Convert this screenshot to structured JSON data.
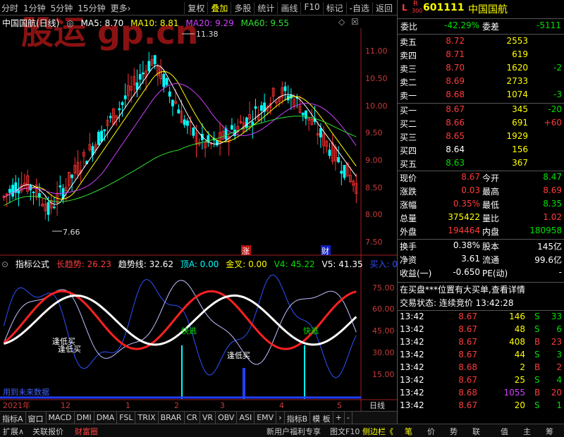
{
  "toolbar": {
    "left": [
      "分时",
      "1分钟",
      "5分钟",
      "15分钟",
      "更多›"
    ],
    "right": [
      "复权",
      "叠加",
      "多股",
      "统计",
      "画线",
      "F10",
      "标记",
      "-自选",
      "返回"
    ]
  },
  "watermark": "股运 gp.cn",
  "chart": {
    "name": "中国国航(日线)",
    "ma5": "MA5: 8.70",
    "ma10": "MA10: 8.81",
    "ma20": "MA20: 9.29",
    "ma60": "MA60: 9.55",
    "y_ticks": [
      "11.00",
      "10.50",
      "10.00",
      "9.50",
      "9.00",
      "8.50",
      "8.00",
      "7.50"
    ],
    "high_label": "11.38",
    "low_label": "7.66",
    "marker_zhang": "涨",
    "marker_cai": "财"
  },
  "indicator": {
    "label": "指标公式",
    "long_trend": "长趋势: 26.23",
    "trend_line": "趋势线: 32.62",
    "top_a": "顶A: 0.00",
    "golden_cross": "金叉: 0.00",
    "v4": "V4: 45.22",
    "v5": "V5: 41.35",
    "buy_in": "买入: 0.00",
    "y_ticks": [
      "75.00",
      "60.00",
      "45.00",
      "30.00",
      "15.00"
    ],
    "text_low_buy1": "逢低买",
    "text_low_buy2": "逢低买",
    "text_quick_sell1": "快逃",
    "text_quick_sell2": "快逃",
    "text_low_buy3": "逢低买",
    "text_future": "用到未来数据"
  },
  "axis": {
    "year": "2021年",
    "months": [
      "12",
      "1",
      "2",
      "3",
      "4",
      "5"
    ],
    "period": "日线"
  },
  "tabs": [
    "指标A",
    "窗口",
    "MACD",
    "DMI",
    "DMA",
    "FSL",
    "TRIX",
    "BRAR",
    "CR",
    "VR",
    "OBV",
    "ASI",
    "EMV",
    "›",
    "指标B",
    "模 板",
    "+",
    "-"
  ],
  "status": {
    "left": [
      "扩展∧",
      "关联报价",
      "财富圈"
    ],
    "right": [
      "新用户福利专享",
      "图文F10",
      "侧边栏《"
    ],
    "panel_tabs": [
      "笔",
      "价",
      "势",
      "联",
      "值",
      "主",
      "筹"
    ]
  },
  "quote": {
    "code": "601111",
    "name": "中国国航",
    "tag_l": "L",
    "tag_r": "R",
    "tag_300": "300",
    "wei_bi_label": "委比",
    "wei_bi": "-42.29%",
    "wei_cha_label": "委差",
    "wei_cha": "-5111",
    "asks": [
      {
        "label": "卖五",
        "price": "8.72",
        "vol": "2553",
        "chg": ""
      },
      {
        "label": "卖四",
        "price": "8.71",
        "vol": "619",
        "chg": ""
      },
      {
        "label": "卖三",
        "price": "8.70",
        "vol": "1620",
        "chg": "-2"
      },
      {
        "label": "卖二",
        "price": "8.69",
        "vol": "2733",
        "chg": ""
      },
      {
        "label": "卖一",
        "price": "8.68",
        "vol": "1074",
        "chg": "-3"
      }
    ],
    "bids": [
      {
        "label": "买一",
        "price": "8.67",
        "vol": "345",
        "chg": "-20"
      },
      {
        "label": "买二",
        "price": "8.66",
        "vol": "691",
        "chg": "+60"
      },
      {
        "label": "买三",
        "price": "8.65",
        "vol": "1929",
        "chg": ""
      },
      {
        "label": "买四",
        "price": "8.64",
        "vol": "156",
        "chg": ""
      },
      {
        "label": "买五",
        "price": "8.63",
        "vol": "367",
        "chg": ""
      }
    ],
    "stats": [
      {
        "l1": "现价",
        "v1": "8.67",
        "l2": "今开",
        "v2": "8.47"
      },
      {
        "l1": "涨跌",
        "v1": "0.03",
        "l2": "最高",
        "v2": "8.69"
      },
      {
        "l1": "涨幅",
        "v1": "0.35%",
        "l2": "最低",
        "v2": "8.35"
      },
      {
        "l1": "总量",
        "v1": "375422",
        "l2": "量比",
        "v2": "1.02"
      },
      {
        "l1": "外盘",
        "v1": "194464",
        "l2": "内盘",
        "v2": "180958"
      }
    ],
    "fund": [
      {
        "l1": "换手",
        "v1": "0.38%",
        "l2": "股本",
        "v2": "145亿"
      },
      {
        "l1": "净资",
        "v1": "3.61",
        "l2": "流通",
        "v2": "99.6亿"
      },
      {
        "l1": "收益(一)",
        "v1": "-0.650",
        "l2": "PE(动)",
        "v2": "-"
      }
    ],
    "notice": "在买盘***位置有大买单,查看详情",
    "trade_status": "交易状态: 连续竞价 13:42:28",
    "ticks": [
      {
        "t": "13:42",
        "p": "8.67",
        "v": "146",
        "s": "S",
        "n": "33"
      },
      {
        "t": "13:42",
        "p": "8.67",
        "v": "48",
        "s": "S",
        "n": "6"
      },
      {
        "t": "13:42",
        "p": "8.67",
        "v": "408",
        "s": "B",
        "n": "23"
      },
      {
        "t": "13:42",
        "p": "8.67",
        "v": "44",
        "s": "S",
        "n": "3"
      },
      {
        "t": "13:42",
        "p": "8.68",
        "v": "2",
        "s": "B",
        "n": "2"
      },
      {
        "t": "13:42",
        "p": "8.67",
        "v": "25",
        "s": "S",
        "n": "4"
      },
      {
        "t": "13:42",
        "p": "8.68",
        "v": "1055",
        "s": "B",
        "n": "20"
      },
      {
        "t": "13:42",
        "p": "8.67",
        "v": "20",
        "s": "S",
        "n": "1"
      }
    ]
  }
}
